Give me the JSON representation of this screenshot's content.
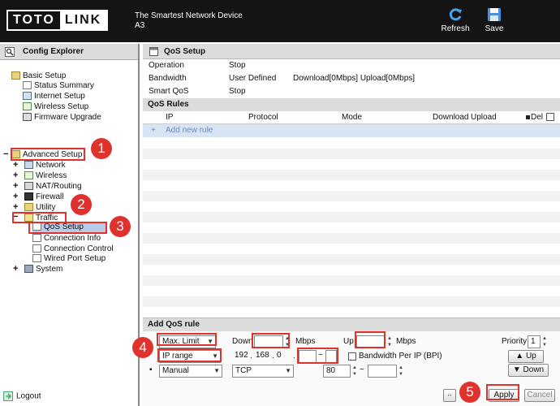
{
  "header": {
    "logo_part1": "TOTO",
    "logo_part2": "LINK",
    "tagline_line1": "The Smartest Network Device",
    "tagline_line2": "A3",
    "refresh_label": "Refresh",
    "save_label": "Save"
  },
  "explorer": {
    "title": "Config Explorer",
    "basic_setup": "Basic Setup",
    "basic_items": [
      "Status Summary",
      "Internet Setup",
      "Wireless Setup",
      "Firmware Upgrade"
    ],
    "advanced_setup": "Advanced Setup",
    "advanced_items": [
      "Network",
      "Wireless",
      "NAT/Routing",
      "Firewall",
      "Utility"
    ],
    "traffic": "Traffic",
    "traffic_items": [
      "QoS Setup",
      "Connection Info",
      "Connection Control",
      "Wired Port Setup"
    ],
    "system": "System",
    "logout": "Logout"
  },
  "qos_setup": {
    "title": "QoS Setup",
    "rows": [
      {
        "label": "Operation",
        "value": "Stop"
      },
      {
        "label": "Bandwidth",
        "value": "User Defined",
        "extra": "Download[0Mbps] Upload[0Mbps]"
      },
      {
        "label": "Smart QoS",
        "value": "Stop"
      }
    ]
  },
  "qos_rules": {
    "title": "QoS Rules",
    "columns": [
      "IP",
      "Protocol",
      "Mode",
      "Download",
      "Upload",
      "Del"
    ],
    "add_new": "Add new rule",
    "add_icon": "+"
  },
  "add_qos": {
    "title": "Add QoS rule",
    "mode_value": "Max. Limit",
    "down_label": "Down",
    "down_value": "",
    "mbps1": "Mbps",
    "up_label": "Up",
    "up_value": "",
    "mbps2": "Mbps",
    "priority_label": "Priority",
    "priority_value": "1",
    "ip_type": "IP range",
    "ip1": "192",
    "ip2": "168",
    "ip3": "0",
    "ip_dot": ".",
    "ip_start": "",
    "tilde": "~",
    "ip_end": "",
    "bpi_label": "Bandwidth Per IP (BPI)",
    "port_type": "Manual",
    "protocol": "TCP",
    "port_start": "80",
    "port_end": "",
    "bullet": "▪",
    "up_btn": "Up",
    "down_btn": "Down",
    "apply_btn": "Apply",
    "cancel_btn": "Cancel"
  },
  "badges": [
    "1",
    "2",
    "3",
    "4",
    "5"
  ],
  "colors": {
    "highlight": "#e0322d",
    "selected": "#b8cbe8"
  }
}
